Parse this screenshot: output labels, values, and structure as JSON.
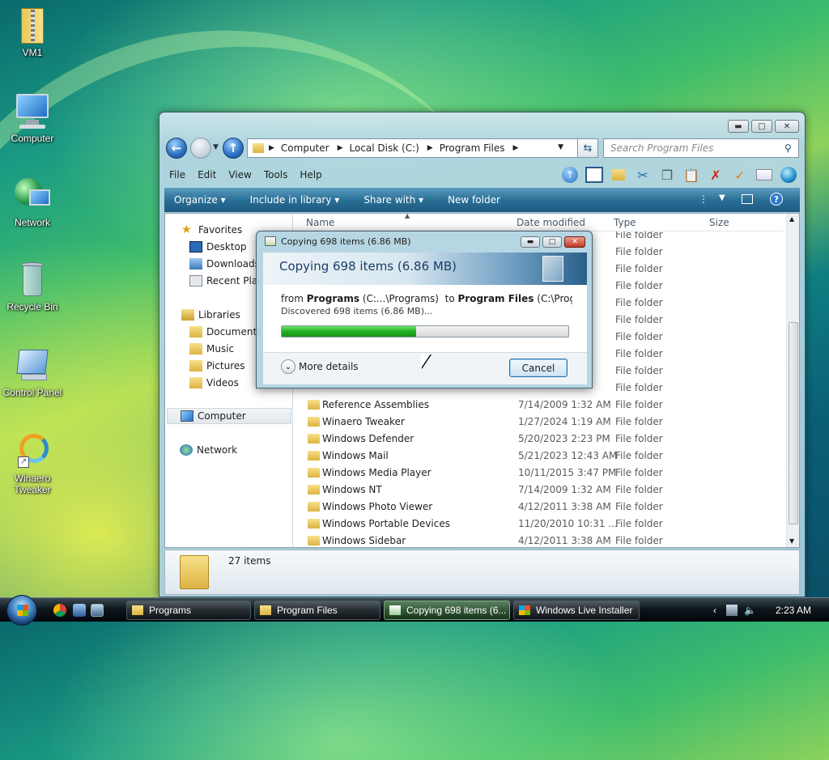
{
  "desktop": {
    "icons": [
      {
        "label": "VM1",
        "icon": "folder-zip-icon"
      },
      {
        "label": "Computer",
        "icon": "computer-icon"
      },
      {
        "label": "Network",
        "icon": "network-icon"
      },
      {
        "label": "Recycle Bin",
        "icon": "recycle-bin-icon"
      },
      {
        "label": "Control Panel",
        "icon": "control-panel-icon"
      },
      {
        "label": "Winaero Tweaker",
        "icon": "winaero-tweaker-icon"
      }
    ]
  },
  "explorer": {
    "address": [
      "Computer",
      "Local Disk (C:)",
      "Program Files"
    ],
    "search_placeholder": "Search Program Files",
    "menu": [
      "File",
      "Edit",
      "View",
      "Tools",
      "Help"
    ],
    "commands": [
      "Organize",
      "Include in library",
      "Share with",
      "New folder"
    ],
    "nav": {
      "favorites": "Favorites",
      "desktop": "Desktop",
      "downloads": "Downloads",
      "recent": "Recent Plac",
      "libraries": "Libraries",
      "documents": "Documents",
      "music": "Music",
      "pictures": "Pictures",
      "videos": "Videos",
      "computer": "Computer",
      "network": "Network"
    },
    "columns": {
      "name": "Name",
      "date": "Date modified",
      "type": "Type",
      "size": "Size"
    },
    "partial_type": "File folder",
    "rows": [
      {
        "name": "Reference Assemblies",
        "date": "7/14/2009 1:32 AM",
        "type": "File folder"
      },
      {
        "name": "Winaero Tweaker",
        "date": "1/27/2024 1:19 AM",
        "type": "File folder"
      },
      {
        "name": "Windows Defender",
        "date": "5/20/2023 2:23 PM",
        "type": "File folder"
      },
      {
        "name": "Windows Mail",
        "date": "5/21/2023 12:43 AM",
        "type": "File folder"
      },
      {
        "name": "Windows Media Player",
        "date": "10/11/2015 3:47 PM",
        "type": "File folder"
      },
      {
        "name": "Windows NT",
        "date": "7/14/2009 1:32 AM",
        "type": "File folder"
      },
      {
        "name": "Windows Photo Viewer",
        "date": "4/12/2011 3:38 AM",
        "type": "File folder"
      },
      {
        "name": "Windows Portable Devices",
        "date": "11/20/2010 10:31 ...",
        "type": "File folder"
      },
      {
        "name": "Windows Sidebar",
        "date": "4/12/2011 3:38 AM",
        "type": "File folder"
      }
    ],
    "item_count": "27 items"
  },
  "copy_dialog": {
    "title": "Copying 698 items (6.86 MB)",
    "heading": "Copying 698 items (6.86 MB)",
    "from_prefix": "from",
    "from_name": "Programs",
    "from_path": "(C:...\\Programs)",
    "to_prefix": "to",
    "to_name": "Program Files",
    "to_path": "(C:\\Program File",
    "discovered": "Discovered 698 items (6.86 MB)...",
    "progress": 0.47,
    "more_details": "More details",
    "cancel": "Cancel"
  },
  "taskbar": {
    "buttons": [
      {
        "label": "Programs",
        "active": false
      },
      {
        "label": "Program Files",
        "active": false
      },
      {
        "label": "Copying 698 items (6...",
        "active": true
      },
      {
        "label": "Windows Live Installer",
        "active": false
      }
    ],
    "clock": "2:23 AM"
  }
}
